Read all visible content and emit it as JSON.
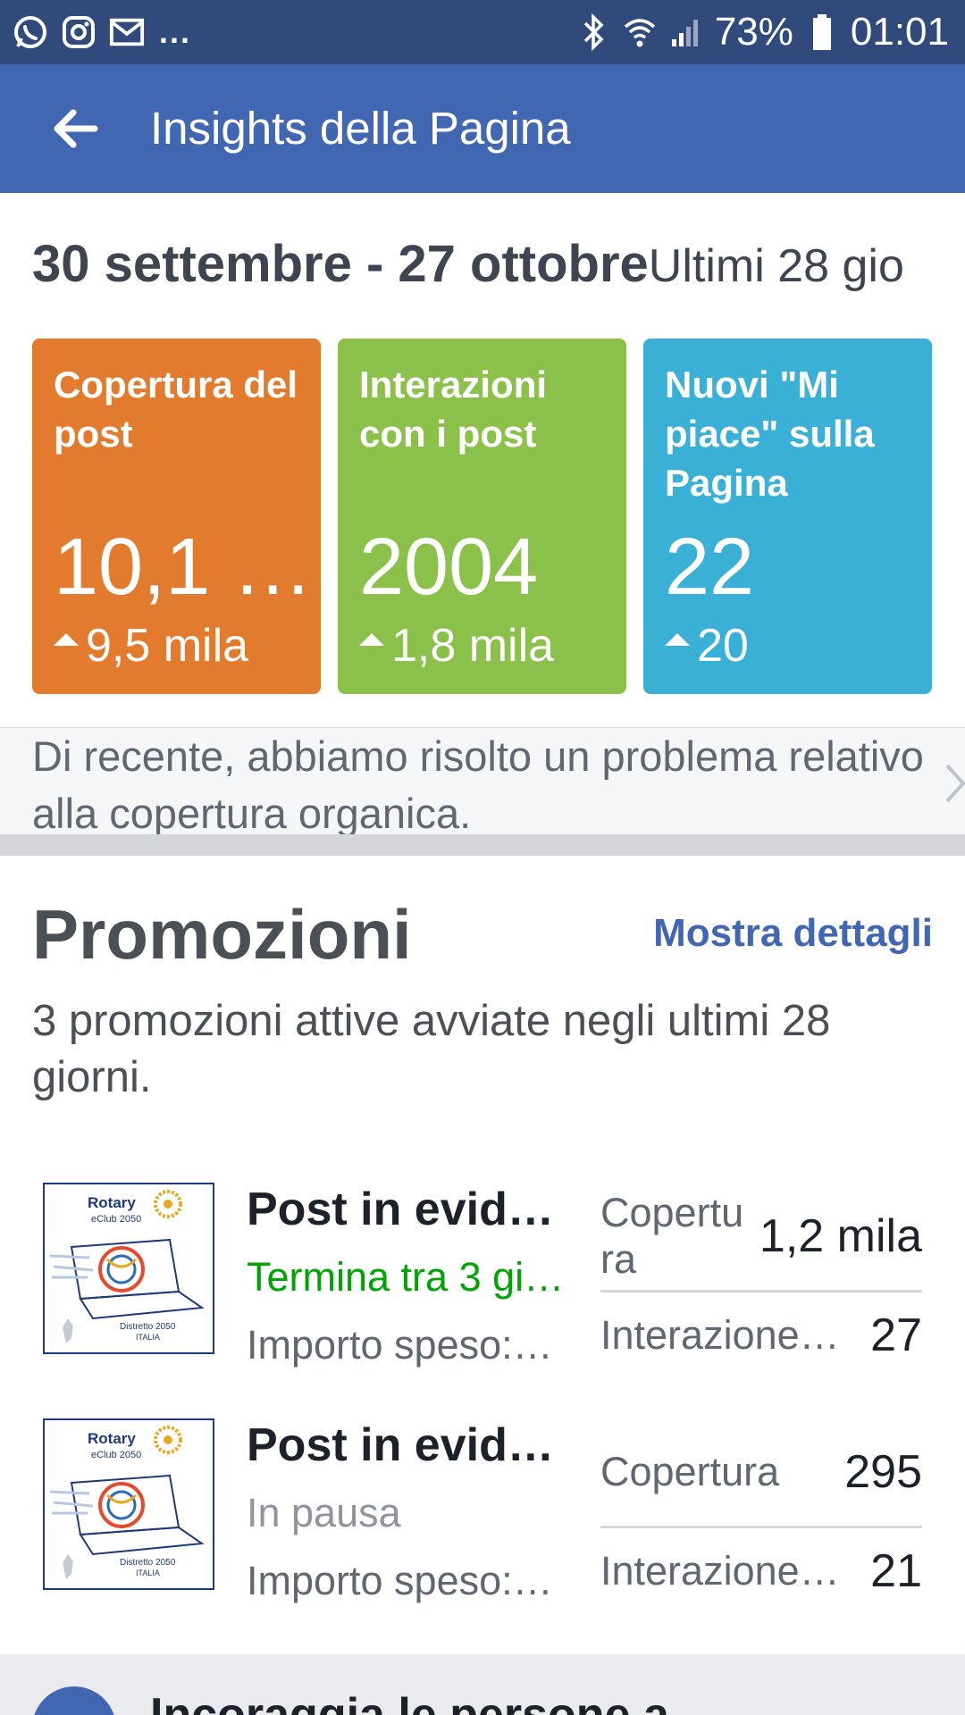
{
  "status_bar": {
    "battery_percent": "73%",
    "time": "01:01",
    "overflow": "...",
    "left_icons": [
      "whatsapp-icon",
      "instagram-icon",
      "gmail-icon"
    ],
    "right_icons": [
      "bluetooth-icon",
      "wifi-icon",
      "signal-icon",
      "battery-icon"
    ]
  },
  "app_bar": {
    "title": "Insights della Pagina",
    "back_icon": "arrow-left-icon",
    "color": "#4267b2"
  },
  "date_range": {
    "range": "30 settembre - 27 ottobre",
    "period": "Ultimi 28 gio"
  },
  "cards": [
    {
      "label": "Copertura del post",
      "value": "10,1 …",
      "delta": "9,5 mila",
      "color": "#e27b2e"
    },
    {
      "label": "Interazioni con i post",
      "value": "2004",
      "delta": "1,8 mila",
      "color": "#8bc04a"
    },
    {
      "label": "Nuovi \"Mi piace\" sulla Pagina",
      "value": "22",
      "delta": "20",
      "color": "#3bb0d6"
    }
  ],
  "notice": {
    "text": "Di recente, abbiamo risolto un problema relativo alla copertura organica."
  },
  "promotions": {
    "title": "Promozioni",
    "details_link": "Mostra dettagli",
    "description": "3 promozioni attive avviate negli ultimi 28 giorni.",
    "items": [
      {
        "title": "Post in evide…",
        "status": "Termina tra 3 gi…",
        "status_color": "#00a400",
        "spent": "Importo speso:…",
        "metric1_label": "Copertu\nra",
        "metric1_value": "1,2 mila",
        "metric2_label": "Interazione…",
        "metric2_value": "27",
        "thumb": {
          "brand": "Rotary",
          "sub": "eClub 2050",
          "footer1": "Distretto 2050",
          "footer2": "ITALIA"
        }
      },
      {
        "title": "Post in evide…",
        "status": "In pausa",
        "status_color": "#90949c",
        "spent": "Importo speso:…",
        "metric1_label": "Copertura",
        "metric1_value": "295",
        "metric2_label": "Interazione…",
        "metric2_value": "21",
        "thumb": {
          "brand": "Rotary",
          "sub": "eClub 2050",
          "footer1": "Distretto 2050",
          "footer2": "ITALIA"
        }
      }
    ]
  },
  "bottom_card": {
    "text": "Incoraggia le persone a"
  }
}
